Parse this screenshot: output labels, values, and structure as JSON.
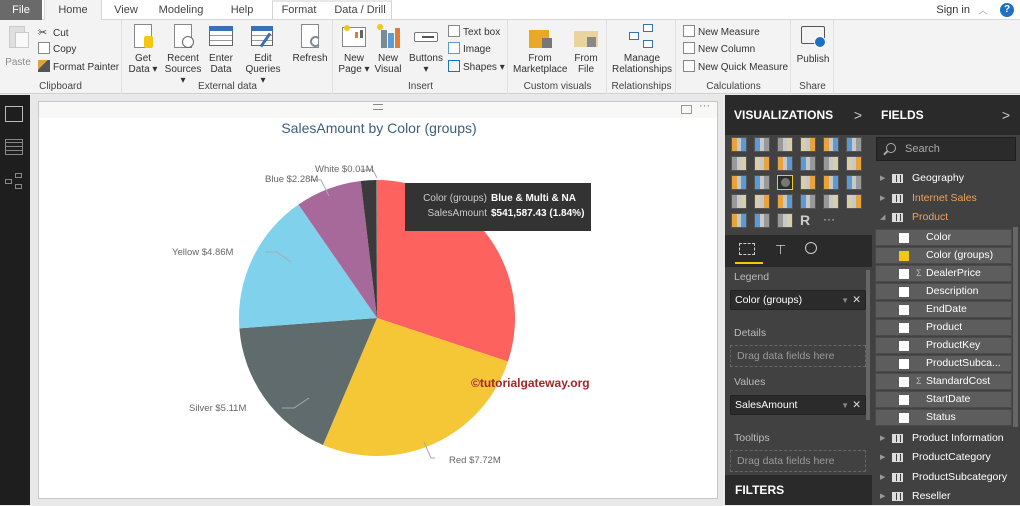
{
  "tabs": [
    {
      "label": "File"
    },
    {
      "label": "Home"
    },
    {
      "label": "View"
    },
    {
      "label": "Modeling"
    },
    {
      "label": "Help"
    },
    {
      "label": "Format"
    },
    {
      "label": "Data / Drill"
    }
  ],
  "account": {
    "sign_in": "Sign in",
    "help": "?"
  },
  "ribbon": {
    "clipboard": {
      "label": "Clipboard",
      "paste": "Paste",
      "cut": "Cut",
      "copy": "Copy",
      "format_painter": "Format Painter"
    },
    "external_data": {
      "label": "External data",
      "get_data": [
        "Get",
        "Data ▾"
      ],
      "recent_sources": [
        "Recent",
        "Sources ▾"
      ],
      "enter_data": [
        "Enter",
        "Data"
      ],
      "edit_queries": [
        "Edit",
        "Queries ▾"
      ],
      "refresh": "Refresh"
    },
    "insert": {
      "label": "Insert",
      "new_page": [
        "New",
        "Page ▾"
      ],
      "new_visual": [
        "New",
        "Visual"
      ],
      "buttons": [
        "Buttons",
        "▾"
      ],
      "text_box": "Text box",
      "image": "Image",
      "shapes": "Shapes ▾"
    },
    "custom_visuals": {
      "label": "Custom visuals",
      "from_marketplace": [
        "From",
        "Marketplace"
      ],
      "from_file": [
        "From",
        "File"
      ]
    },
    "relationships": {
      "label": "Relationships",
      "manage": [
        "Manage",
        "Relationships"
      ]
    },
    "calculations": {
      "label": "Calculations",
      "new_measure": "New Measure",
      "new_column": "New Column",
      "new_quick_measure": "New Quick Measure"
    },
    "share": {
      "label": "Share",
      "publish": "Publish"
    }
  },
  "visual": {
    "tooltip": {
      "rows": [
        {
          "key": "Color (groups)",
          "value": "Blue & Multi & NA"
        },
        {
          "key": "SalesAmount",
          "value": "$541,587.43 (1.84%)"
        }
      ]
    },
    "watermark": "©tutorialgateway.org"
  },
  "chart_data": {
    "type": "pie",
    "title": "SalesAmount by Color (groups)",
    "slices": [
      {
        "name": "(label hidden by tooltip)",
        "value": 8.84,
        "color": "#fd625e",
        "label": ""
      },
      {
        "name": "Red",
        "value": 7.72,
        "color": "#f5c636",
        "label": "Red $7.72M"
      },
      {
        "name": "Silver",
        "value": 5.11,
        "color": "#5f6b6d",
        "label": "Silver $5.11M"
      },
      {
        "name": "Yellow",
        "value": 4.86,
        "color": "#7fd1ec",
        "label": "Yellow $4.86M"
      },
      {
        "name": "Blue",
        "value": 2.28,
        "color": "#a66999",
        "label": "Blue $2.28M"
      },
      {
        "name": "Blue & Multi & NA",
        "value": 0.54,
        "color": "#3a3a3a",
        "label": ""
      },
      {
        "name": "White",
        "value": 0.01,
        "color": "#dddddd",
        "label": "White $0.01M"
      }
    ],
    "units": "$M"
  },
  "visualizations": {
    "title": "VISUALIZATIONS",
    "legend_label": "Legend",
    "legend_field": "Color (groups)",
    "details_label": "Details",
    "details_placeholder": "Drag data fields here",
    "values_label": "Values",
    "values_field": "SalesAmount",
    "tooltips_label": "Tooltips",
    "tooltips_placeholder": "Drag data fields here",
    "filters_title": "FILTERS",
    "more": "···",
    "r_visual": "R"
  },
  "fields": {
    "title": "FIELDS",
    "search_placeholder": "Search",
    "tables_top": [
      {
        "name": "Geography",
        "highlight": false
      },
      {
        "name": "Internet Sales",
        "highlight": true
      },
      {
        "name": "Product",
        "highlight": true,
        "expanded": true
      }
    ],
    "product_fields": [
      {
        "name": "Color",
        "checked": false,
        "sigma": false
      },
      {
        "name": "Color (groups)",
        "checked": true,
        "sigma": false
      },
      {
        "name": "DealerPrice",
        "checked": false,
        "sigma": true
      },
      {
        "name": "Description",
        "checked": false,
        "sigma": false
      },
      {
        "name": "EndDate",
        "checked": false,
        "sigma": false
      },
      {
        "name": "Product",
        "checked": false,
        "sigma": false
      },
      {
        "name": "ProductKey",
        "checked": false,
        "sigma": false
      },
      {
        "name": "ProductSubca...",
        "checked": false,
        "sigma": false
      },
      {
        "name": "StandardCost",
        "checked": false,
        "sigma": true
      },
      {
        "name": "StartDate",
        "checked": false,
        "sigma": false
      },
      {
        "name": "Status",
        "checked": false,
        "sigma": false
      }
    ],
    "tables_bottom": [
      {
        "name": "Product Information"
      },
      {
        "name": "ProductCategory"
      },
      {
        "name": "ProductSubcategory"
      },
      {
        "name": "Reseller"
      }
    ]
  }
}
